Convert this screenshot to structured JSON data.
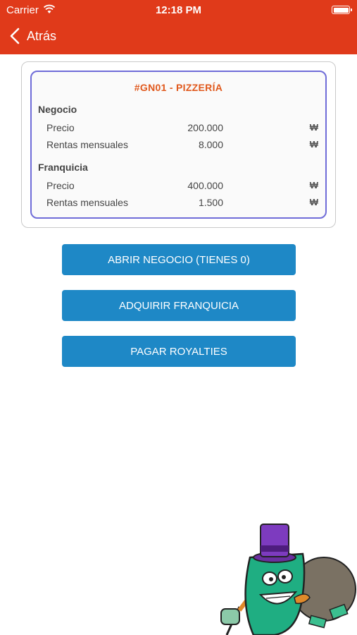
{
  "status": {
    "carrier": "Carrier",
    "time": "12:18 PM"
  },
  "nav": {
    "back_label": "Atrás"
  },
  "card": {
    "title": "#GN01 - PIZZERÍA",
    "currency_symbol": "₩",
    "negocio": {
      "heading": "Negocio",
      "rows": [
        {
          "label": "Precio",
          "value": "200.000"
        },
        {
          "label": "Rentas mensuales",
          "value": "8.000"
        }
      ]
    },
    "franquicia": {
      "heading": "Franquicia",
      "rows": [
        {
          "label": "Precio",
          "value": "400.000"
        },
        {
          "label": "Rentas mensuales",
          "value": "1.500"
        }
      ]
    }
  },
  "actions": {
    "open_business": "ABRIR NEGOCIO (TIENES 0)",
    "acquire_franchise": "ADQUIRIR FRANQUICIA",
    "pay_royalties": "PAGAR ROYALTIES"
  },
  "colors": {
    "nav_bg": "#e03a1a",
    "title_orange": "#e0581c",
    "button_blue": "#1e88c6",
    "card_border": "#6f6cd8"
  }
}
